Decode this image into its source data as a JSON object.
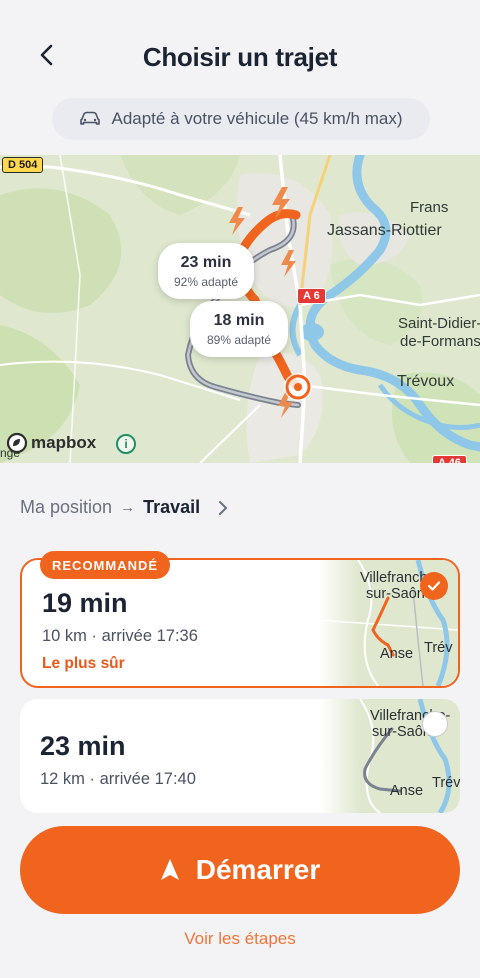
{
  "header": {
    "title": "Choisir un trajet",
    "back_icon": "chevron-left-icon"
  },
  "vehicle_chip": {
    "icon": "car-icon",
    "label": "Adapté à votre véhicule (45 km/h max)"
  },
  "map": {
    "labels": {
      "frans": "Frans",
      "jassans": "Jassans-Riottier",
      "saint_didier": "Saint-Didier-",
      "de_formans": "de-Formans",
      "trevoux": "Trévoux",
      "partial_left": "nge"
    },
    "road_shields": {
      "d504": "D 504",
      "a6": "A 6",
      "a46": "A 46"
    },
    "bubbles": [
      {
        "time": "23 min",
        "pct": "92% adapté"
      },
      {
        "time": "18 min",
        "pct": "89% adapté"
      }
    ],
    "attribution": "mapbox",
    "info_glyph": "i",
    "colors": {
      "route_active": "#f0641e",
      "route_alt": "#7b8290",
      "water": "#8fc7e8"
    }
  },
  "breadcrumb": {
    "origin": "Ma position",
    "arrow": "→",
    "destination": "Travail"
  },
  "routes": [
    {
      "badge": "RECOMMANDÉ",
      "time": "19 min",
      "meta": "10 km · arrivée 17:36",
      "tag": "Le plus sûr",
      "selected": true,
      "thumb": {
        "line1": "Villefranche-",
        "line2": "sur-Saône",
        "left": "Anse",
        "right": "Trév"
      }
    },
    {
      "time": "23 min",
      "meta": "12 km · arrivée 17:40",
      "selected": false,
      "thumb": {
        "line1": "Villefranche-",
        "line2": "sur-Saône",
        "left": "Anse",
        "right": "Trév"
      }
    }
  ],
  "start_button": {
    "label": "Démarrer",
    "icon": "navigation-arrow-icon"
  },
  "steps_link": "Voir les étapes",
  "colors": {
    "accent": "#f0641e",
    "text_dark": "#1c2333",
    "background": "#f3f3f6"
  }
}
